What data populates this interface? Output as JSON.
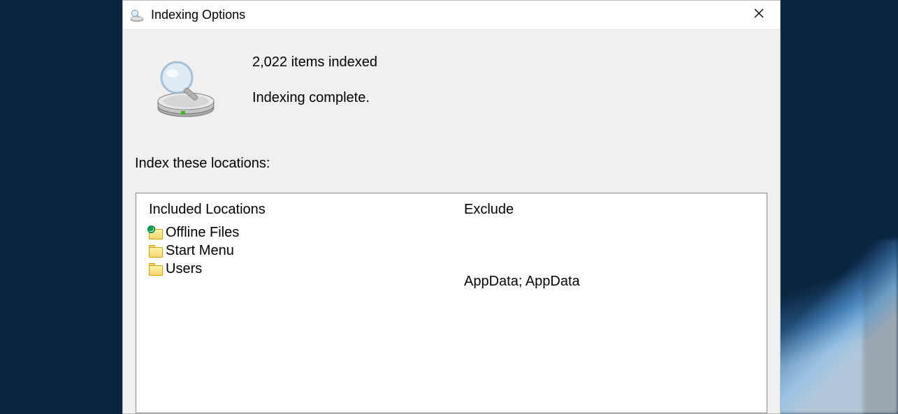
{
  "window": {
    "title": "Indexing Options"
  },
  "status": {
    "count_text": "2,022 items indexed",
    "complete_text": "Indexing complete."
  },
  "locations": {
    "label": "Index these locations:",
    "included_header": "Included Locations",
    "exclude_header": "Exclude",
    "items": [
      {
        "label": "Offline Files",
        "has_sync": true,
        "exclude": ""
      },
      {
        "label": "Start Menu",
        "has_sync": false,
        "exclude": ""
      },
      {
        "label": "Users",
        "has_sync": false,
        "exclude": "AppData; AppData"
      }
    ]
  }
}
